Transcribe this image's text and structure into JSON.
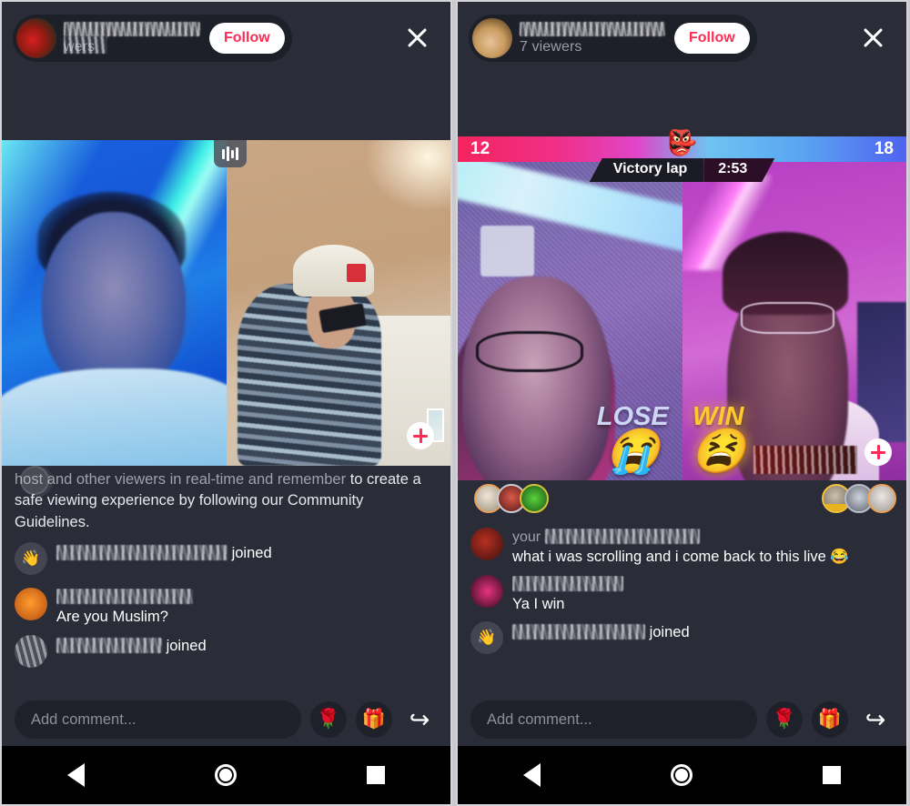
{
  "panels": [
    {
      "id": "left",
      "header": {
        "host_name": "[redacted]",
        "viewers": "[redacted] viewers",
        "viewers_suffix": "wers",
        "follow_label": "Follow",
        "close_icon": "close-icon",
        "avatar": "host-avatar"
      },
      "video": {
        "audio_icon": "audio-visualizer-icon",
        "plus_label": "+",
        "left_scene": "person-lying-in-blue-light",
        "right_scene": "person-in-kitchen-with-cap"
      },
      "comments": [
        {
          "type": "system",
          "text_dim": "host and other viewers in real-time and remember",
          "text": "to create a safe viewing experience by following our Community Guidelines."
        },
        {
          "type": "join",
          "avatar": "wave-emoji-avatar",
          "avatar_glyph": "👋",
          "name": "[redacted]",
          "action": "joined",
          "name_width": 188
        },
        {
          "type": "message",
          "avatar": "redacted-orange-avatar",
          "name": "[redacted]",
          "name_width": 150,
          "text": "Are you Muslim?"
        },
        {
          "type": "join",
          "avatar": "redacted-gray-avatar",
          "name": "[redacted]",
          "action": "joined",
          "name_width": 116
        }
      ],
      "composer": {
        "placeholder": "Add comment...",
        "rose_icon": "🌹",
        "gift_icon": "🎁",
        "share_icon": "↪"
      }
    },
    {
      "id": "right",
      "header": {
        "host_name": "[redacted]",
        "viewers": "7 viewers",
        "follow_label": "Follow",
        "close_icon": "close-icon",
        "avatar": "host-avatar"
      },
      "game": {
        "score_left": "12",
        "score_right": "18",
        "crown_icon": "👺",
        "stage_label": "Victory lap",
        "timer": "2:53",
        "bar_color_left": "#f5245e",
        "bar_color_right": "#4f63ef"
      },
      "video": {
        "left_scene": "woman-with-glasses-purple-light",
        "right_scene": "man-with-glasses-pink-light",
        "left_result": "LOSE",
        "left_result_emoji": "😭",
        "left_result_color": "#cdd6f5",
        "right_result": "WIN",
        "right_result_emoji": "😫",
        "right_result_color": "#ffc933",
        "plus_label": "+"
      },
      "comments": [
        {
          "type": "message",
          "avatar": "redacted-red-avatar",
          "name": "your [redacted]",
          "name_prefix": "your",
          "name_width": 170,
          "text": "what i was scrolling and i come back to this live 😂"
        },
        {
          "type": "message",
          "avatar": "redacted-pink-avatar",
          "name": "[redacted]",
          "name_width": 122,
          "text": "Ya I win"
        },
        {
          "type": "join",
          "avatar": "wave-emoji-avatar",
          "avatar_glyph": "👋",
          "name": "[redacted]",
          "action": "joined",
          "name_width": 146
        }
      ],
      "composer": {
        "placeholder": "Add comment...",
        "rose_icon": "🌹",
        "gift_icon": "🎁",
        "share_icon": "↪"
      }
    }
  ],
  "nav": {
    "back_icon": "back-triangle-icon",
    "home_icon": "home-circle-icon",
    "recents_icon": "recents-square-icon"
  },
  "colors": {
    "accent_pink": "#fe2c55",
    "panel_bg": "#2a2d38",
    "chip_bg": "#1d1f29",
    "nav_bg": "#000000"
  }
}
